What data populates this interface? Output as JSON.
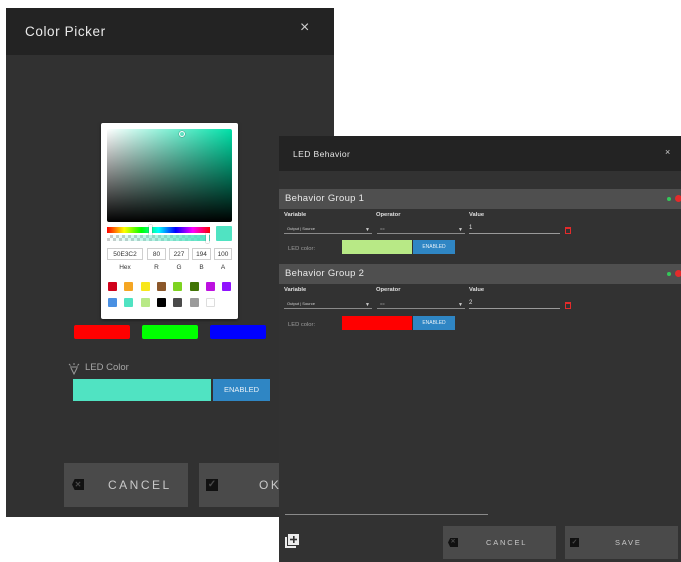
{
  "color_picker": {
    "title": "Color Picker",
    "close_glyph": "×",
    "hex_value": "50E3C2",
    "r_value": "80",
    "g_value": "227",
    "b_value": "194",
    "a_value": "100",
    "labels": {
      "hex": "Hex",
      "r": "R",
      "g": "G",
      "b": "B",
      "a": "A"
    },
    "preset_colors": [
      "#d0021b",
      "#f5a623",
      "#f8e71c",
      "#8b572a",
      "#7ed321",
      "#417505",
      "#bd10e0",
      "#9013fe",
      "#4a90e2",
      "#50e3c2",
      "#b8e986",
      "#000000",
      "#4a4a4a",
      "#9b9b9b",
      "#ffffff"
    ],
    "quick_colors": [
      "#ff0000",
      "#00ff00",
      "#0000ff"
    ],
    "led_color_label": "LED Color",
    "led_color_value": "#50e3c2",
    "enabled_label": "ENABLED",
    "cancel_label": "CANCEL",
    "ok_label": "OK",
    "icons": {
      "close": "close-icon",
      "bulb": "lightbulb-icon",
      "cancel": "backspace-icon",
      "ok": "checkbox-icon"
    }
  },
  "led_behavior": {
    "title": "LED Behavior",
    "close_glyph": "×",
    "column_labels": {
      "variable": "Variable",
      "operator": "Operator",
      "value": "Value"
    },
    "led_color_label": "LED color:",
    "enabled_label": "ENABLED",
    "groups": [
      {
        "title": "Behavior Group 1",
        "variable": "Output | Source",
        "operator": "==",
        "value": "1",
        "led_color": "#b8e986"
      },
      {
        "title": "Behavior Group 2",
        "variable": "Output | Source",
        "operator": "==",
        "value": "2",
        "led_color": "#ff0000"
      }
    ],
    "cancel_label": "CANCEL",
    "save_label": "SAVE",
    "icons": {
      "add": "add-group-icon",
      "delete": "trash-icon",
      "cancel": "backspace-icon",
      "save": "checkbox-icon"
    }
  }
}
